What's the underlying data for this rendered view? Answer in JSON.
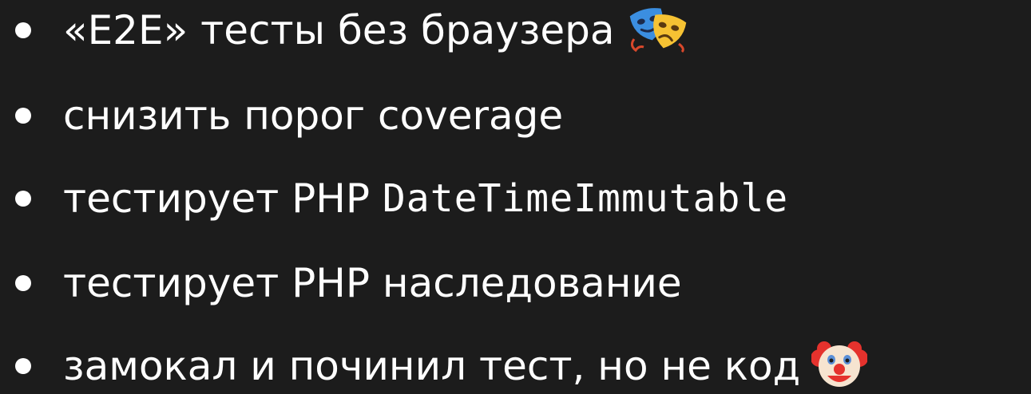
{
  "colors": {
    "background": "#1c1c1c",
    "text": "#ffffff"
  },
  "bullets": [
    {
      "text": "«E2E» тесты без браузера",
      "icon": "performing-arts-masks-icon"
    },
    {
      "text": "снизить порог coverage"
    },
    {
      "text": "тестирует PHP ",
      "code": "DateTimeImmutable"
    },
    {
      "text": "тестирует PHP наследование"
    },
    {
      "text": "замокал и починил тест, но не код",
      "icon": "clown-face-icon"
    }
  ]
}
